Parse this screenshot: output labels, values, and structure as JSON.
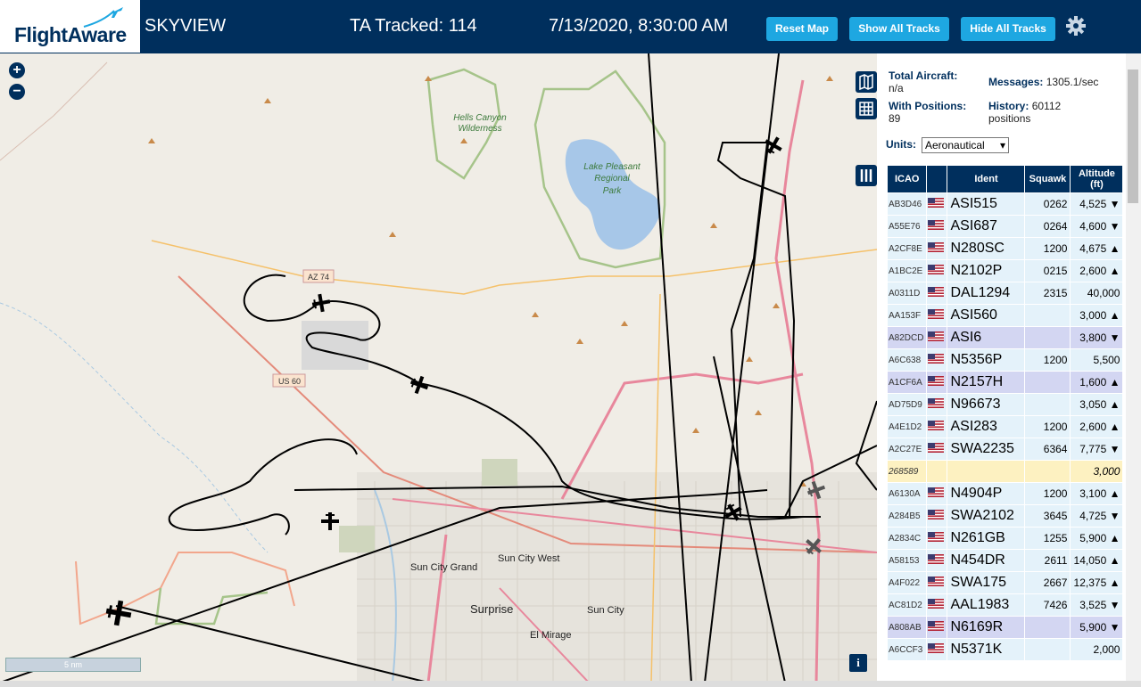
{
  "header": {
    "logo_text": "FlightAware",
    "app_title": "SKYVIEW",
    "tracked_label": "TA Tracked: 114",
    "datetime": "7/13/2020, 8:30:00 AM",
    "buttons": {
      "reset": "Reset Map",
      "show": "Show All Tracks",
      "hide": "Hide All Tracks"
    }
  },
  "map": {
    "zoom_in": "+",
    "zoom_out": "−",
    "scale": "5 nm",
    "info": "i",
    "labels": {
      "hells_canyon_1": "Hells Canyon",
      "hells_canyon_2": "Wilderness",
      "lake_1": "Lake Pleasant",
      "lake_2": "Regional",
      "lake_3": "Park",
      "az74": "AZ 74",
      "us60": "US 60",
      "sun_city_grand": "Sun City Grand",
      "sun_city_west": "Sun City West",
      "surprise": "Surprise",
      "sun_city": "Sun City",
      "el_mirage": "El Mirage"
    }
  },
  "panel": {
    "total_aircraft_label": "Total Aircraft:",
    "total_aircraft_value": "n/a",
    "with_positions_label": "With Positions:",
    "with_positions_value": "89",
    "messages_label": "Messages:",
    "messages_value": "1305.1/sec",
    "history_label": "History:",
    "history_value": "60112",
    "history_unit": "positions",
    "units_label": "Units:",
    "units_value": "Aeronautical",
    "columns": {
      "icao": "ICAO",
      "ident": "Ident",
      "squawk": "Squawk",
      "alt1": "Altitude",
      "alt2": "(ft)"
    }
  },
  "aircraft": [
    {
      "icao": "AB3D46",
      "ident": "ASI515",
      "squawk": "0262",
      "alt": "4,525 ▼",
      "bg": "#e4f2fa",
      "flag": true
    },
    {
      "icao": "A55E76",
      "ident": "ASI687",
      "squawk": "0264",
      "alt": "4,600 ▼",
      "bg": "#e4f2fa",
      "flag": true
    },
    {
      "icao": "A2CF8E",
      "ident": "N280SC",
      "squawk": "1200",
      "alt": "4,675 ▲",
      "bg": "#e4f2fa",
      "flag": true
    },
    {
      "icao": "A1BC2E",
      "ident": "N2102P",
      "squawk": "0215",
      "alt": "2,600 ▲",
      "bg": "#e4f2fa",
      "flag": true
    },
    {
      "icao": "A0311D",
      "ident": "DAL1294",
      "squawk": "2315",
      "alt": "40,000",
      "bg": "#e4f2fa",
      "flag": true
    },
    {
      "icao": "AA153F",
      "ident": "ASI560",
      "squawk": "",
      "alt": "3,000 ▲",
      "bg": "#e4f2fa",
      "flag": true
    },
    {
      "icao": "A82DCD",
      "ident": "ASI6",
      "squawk": "",
      "alt": "3,800 ▼",
      "bg": "#d3d6f2",
      "flag": true
    },
    {
      "icao": "A6C638",
      "ident": "N5356P",
      "squawk": "1200",
      "alt": "5,500",
      "bg": "#e4f2fa",
      "flag": true
    },
    {
      "icao": "A1CF6A",
      "ident": "N2157H",
      "squawk": "",
      "alt": "1,600 ▲",
      "bg": "#d3d6f2",
      "flag": true
    },
    {
      "icao": "AD75D9",
      "ident": "N96673",
      "squawk": "",
      "alt": "3,050 ▲",
      "bg": "#e4f2fa",
      "flag": true
    },
    {
      "icao": "A4E1D2",
      "ident": "ASI283",
      "squawk": "1200",
      "alt": "2,600 ▲",
      "bg": "#e4f2fa",
      "flag": true
    },
    {
      "icao": "A2C27E",
      "ident": "SWA2235",
      "squawk": "6364",
      "alt": "7,775 ▼",
      "bg": "#e4f2fa",
      "flag": true
    },
    {
      "icao": "268589",
      "ident": "",
      "squawk": "",
      "alt": "3,000",
      "bg": "#fdf1c1",
      "flag": false
    },
    {
      "icao": "A6130A",
      "ident": "N4904P",
      "squawk": "1200",
      "alt": "3,100 ▲",
      "bg": "#e4f2fa",
      "flag": true
    },
    {
      "icao": "A284B5",
      "ident": "SWA2102",
      "squawk": "3645",
      "alt": "4,725 ▼",
      "bg": "#e4f2fa",
      "flag": true
    },
    {
      "icao": "A2834C",
      "ident": "N261GB",
      "squawk": "1255",
      "alt": "5,900 ▲",
      "bg": "#e4f2fa",
      "flag": true
    },
    {
      "icao": "A58153",
      "ident": "N454DR",
      "squawk": "2611",
      "alt": "14,050 ▲",
      "bg": "#e4f2fa",
      "flag": true
    },
    {
      "icao": "A4F022",
      "ident": "SWA175",
      "squawk": "2667",
      "alt": "12,375 ▲",
      "bg": "#e4f2fa",
      "flag": true
    },
    {
      "icao": "AC81D2",
      "ident": "AAL1983",
      "squawk": "7426",
      "alt": "3,525 ▼",
      "bg": "#e4f2fa",
      "flag": true
    },
    {
      "icao": "A808AB",
      "ident": "N6169R",
      "squawk": "",
      "alt": "5,900 ▼",
      "bg": "#d3d6f2",
      "flag": true
    },
    {
      "icao": "A6CCF3",
      "ident": "N5371K",
      "squawk": "",
      "alt": "2,000",
      "bg": "#e4f2fa",
      "flag": true
    }
  ]
}
